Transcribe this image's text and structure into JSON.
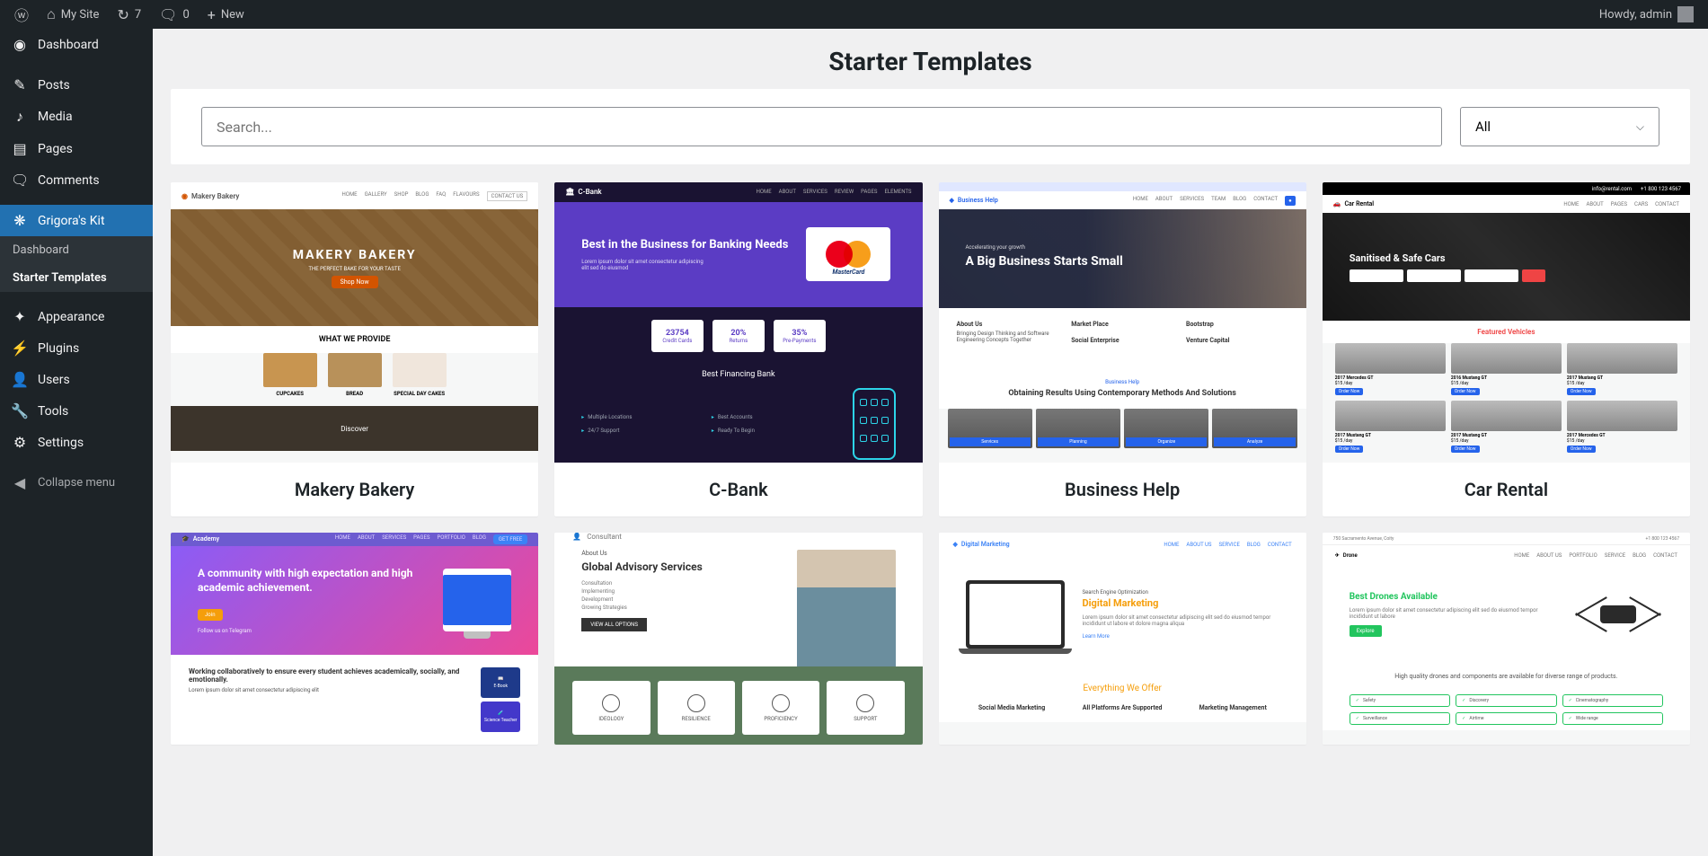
{
  "adminbar": {
    "site_name": "My Site",
    "updates_count": "7",
    "comments_count": "0",
    "new_label": "New",
    "howdy": "Howdy, admin"
  },
  "sidebar": {
    "items": [
      {
        "label": "Dashboard"
      },
      {
        "label": "Posts"
      },
      {
        "label": "Media"
      },
      {
        "label": "Pages"
      },
      {
        "label": "Comments"
      },
      {
        "label": "Grigora's Kit"
      },
      {
        "label": "Appearance"
      },
      {
        "label": "Plugins"
      },
      {
        "label": "Users"
      },
      {
        "label": "Tools"
      },
      {
        "label": "Settings"
      }
    ],
    "submenu": [
      {
        "label": "Dashboard"
      },
      {
        "label": "Starter Templates"
      }
    ],
    "collapse": "Collapse menu"
  },
  "page": {
    "title": "Starter Templates",
    "search_placeholder": "Search...",
    "filter": "All"
  },
  "templates": [
    {
      "name": "Makery Bakery"
    },
    {
      "name": "C-Bank"
    },
    {
      "name": "Business Help"
    },
    {
      "name": "Car Rental"
    },
    {
      "name": "Academy"
    },
    {
      "name": "Consultant"
    },
    {
      "name": "Digital Marketing"
    },
    {
      "name": "Drone"
    }
  ],
  "thumb": {
    "bakery": {
      "logo": "Makery Bakery",
      "hero": "MAKERY BAKERY",
      "sub": "THE PERFECT BAKE FOR YOUR TASTE",
      "btn": "Shop Now",
      "provide": "WHAT WE PROVIDE",
      "items": [
        "CUPCAKES",
        "BREAD",
        "SPECIAL DAY CAKES"
      ],
      "foot": "Discover"
    },
    "cbank": {
      "logo": "C-Bank",
      "hero": "Best in the Business for Banking Needs",
      "mc": "MasterCard",
      "stats": [
        {
          "v": "23754",
          "l": "Credit Cards"
        },
        {
          "v": "20%",
          "l": "Returns"
        },
        {
          "v": "35%",
          "l": "Pre-Payments"
        }
      ],
      "sub": "Best Financing Bank",
      "features": [
        "Multiple Locations",
        "Best Accounts",
        "24/7 Support",
        "Ready To Begin"
      ]
    },
    "business": {
      "logo": "Business Help",
      "small": "Accelerating your growth",
      "hero": "A Big Business Starts Small",
      "col1": "About Us",
      "col1t": "Bringing Design Thinking and Software Engineering Concepts Together",
      "col2a": "Market Place",
      "col2b": "Social Enterprise",
      "col3a": "Bootstrap",
      "col3b": "Venture Capital",
      "ressmall": "Business Help",
      "res": "Obtaining Results Using Contemporary Methods And Solutions",
      "cards": [
        "Services",
        "Planning",
        "Organize",
        "Analyze"
      ]
    },
    "car": {
      "top": [
        "info@rental.com",
        "+1 800 123 4567"
      ],
      "logo": "Car Rental",
      "hero": "Sanitised & Safe Cars",
      "featured": "Featured Vehicles",
      "items": [
        {
          "t": "2017 Mercedes GT",
          "p": "$15 /day"
        },
        {
          "t": "2016 Mustang GT",
          "p": "$15 /day"
        },
        {
          "t": "2017 Mustang GT",
          "p": "$15 /day"
        },
        {
          "t": "2017 Mustang GT",
          "p": "$15 /day"
        },
        {
          "t": "2017 Mustang GT",
          "p": "$15 /day"
        },
        {
          "t": "2017 Mercedes GT",
          "p": "$15 /day"
        }
      ],
      "btn": "Order Now"
    },
    "academy": {
      "logo": "Academy",
      "hero": "A community with high expectation and high academic achievement.",
      "btn": "Join",
      "follow": "Follow us on Telegram",
      "heading": "Working collaboratively to ensure every student achieves academically, socially, and emotionally.",
      "btns": [
        "E-Book",
        "Science Teacher"
      ]
    },
    "consultant": {
      "logo": "Consultant",
      "about": "About Us",
      "hero": "Global Advisory Services",
      "bullets": [
        "Consultation",
        "Implementing",
        "Development",
        "Growing Strategies"
      ],
      "btn": "VIEW ALL OPTIONS",
      "cards": [
        "IDEOLOGY",
        "RESILIENCE",
        "PROFICIENCY",
        "SUPPORT"
      ]
    },
    "digital": {
      "logo": "Digital Marketing",
      "small": "Search Engine Optimization",
      "hero_a": "Digital ",
      "hero_b": "Marketing",
      "link": "Learn More",
      "offer_a": "Everything We ",
      "offer_b": "Offer",
      "cols": [
        "Social Media Marketing",
        "All Platforms Are Supported",
        "Marketing Management"
      ]
    },
    "drone": {
      "top": "750 Sacramento Avenue, Coity",
      "phone": "+1 800 123 4567",
      "logo": "Drone",
      "hero": "Best Drones Available",
      "btn": "Explore",
      "sub": "High quality drones and components are available for diverse range of products.",
      "pills": [
        "Safety",
        "Discovery",
        "Cinematography",
        "Surveillance",
        "Airtime",
        "Wide range"
      ]
    }
  }
}
